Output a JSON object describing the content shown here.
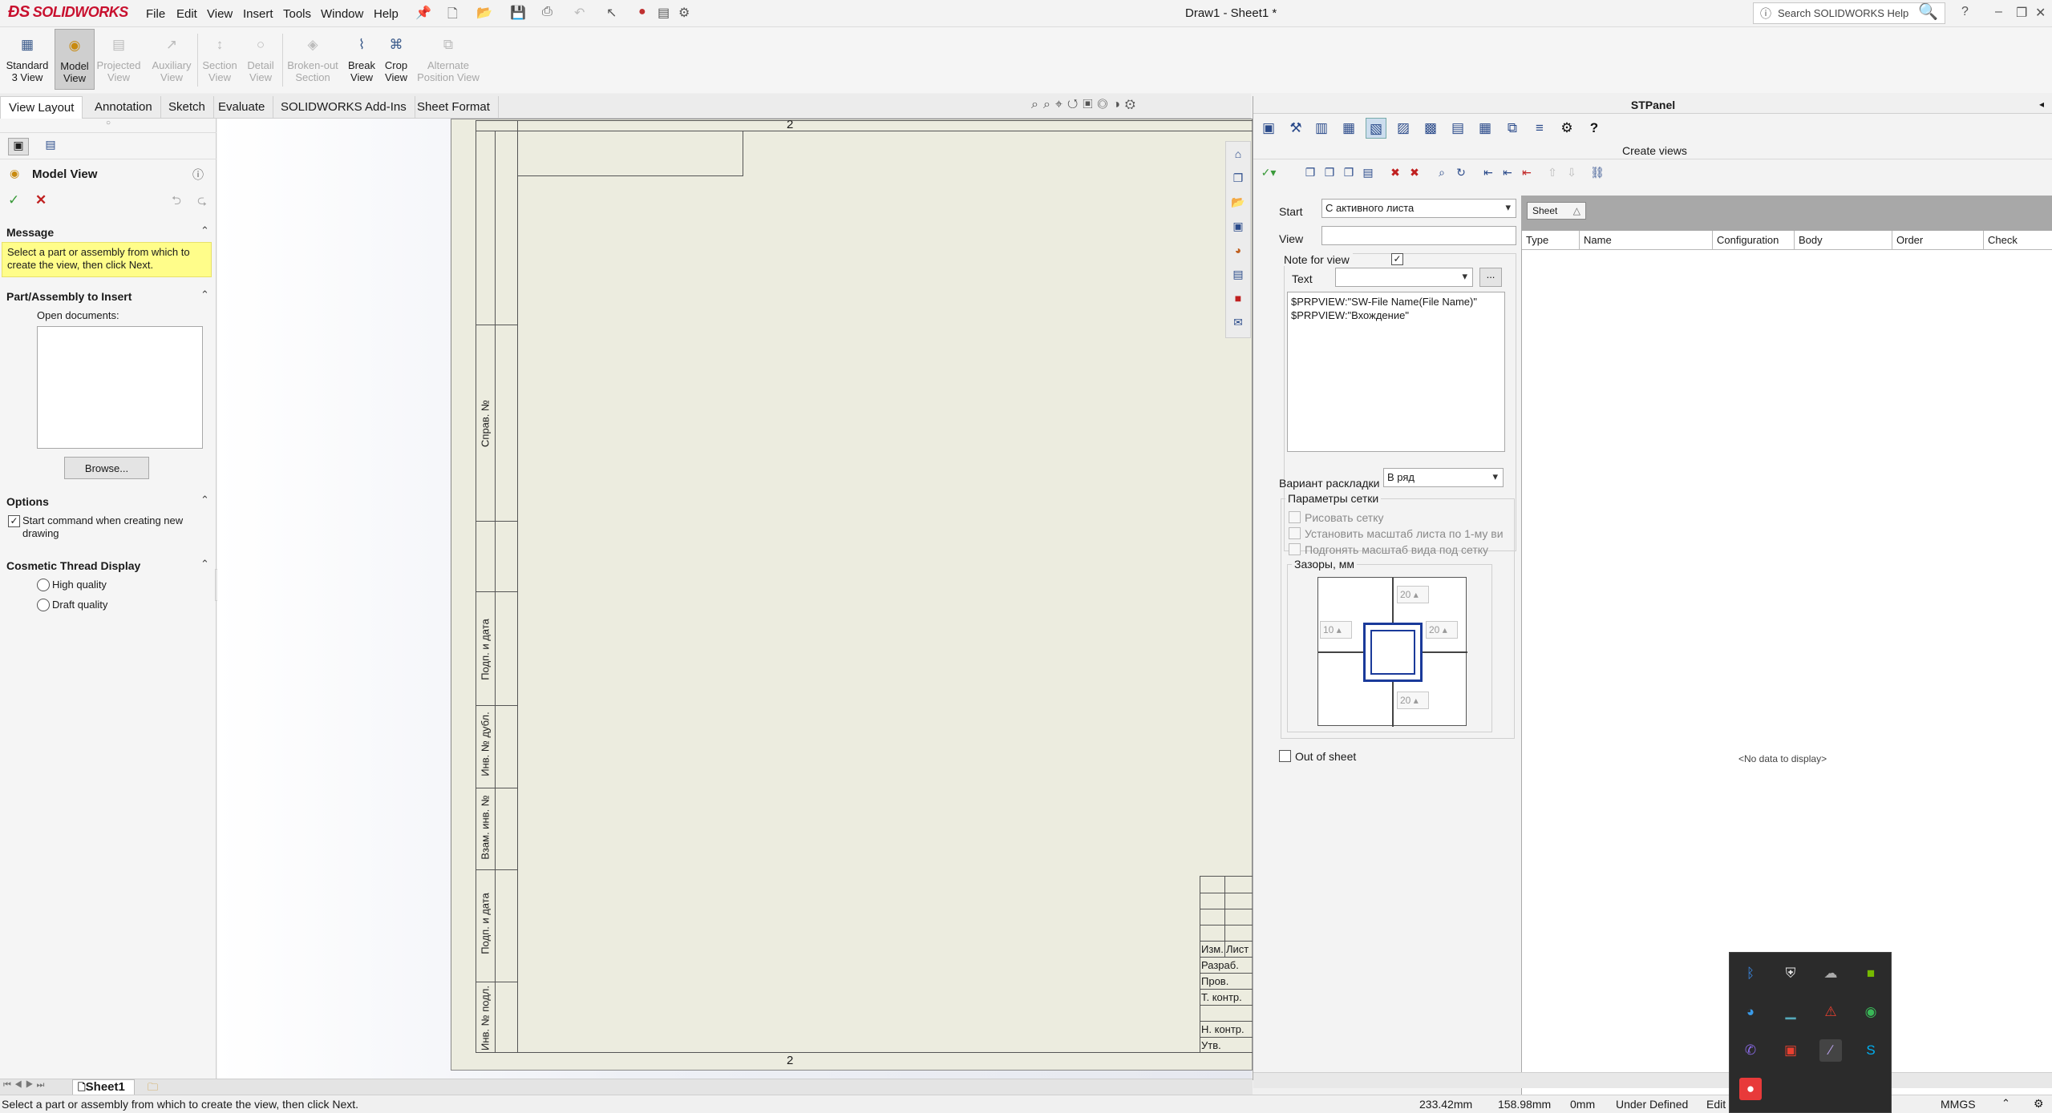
{
  "app": {
    "brand": "SOLIDWORKS",
    "window_title": "Draw1 - Sheet1 *",
    "help_search_placeholder": "Search SOLIDWORKS Help"
  },
  "menu": [
    "File",
    "Edit",
    "View",
    "Insert",
    "Tools",
    "Window",
    "Help"
  ],
  "commands": [
    {
      "label": "Standard 3 View",
      "icon": "standard-3-view-icon",
      "enabled": true,
      "active": false
    },
    {
      "label": "Model View",
      "icon": "model-view-icon",
      "enabled": true,
      "active": true
    },
    {
      "label": "Projected View",
      "icon": "projected-view-icon",
      "enabled": false
    },
    {
      "label": "Auxiliary View",
      "icon": "auxiliary-view-icon",
      "enabled": false
    },
    {
      "label": "Section View",
      "icon": "section-view-icon",
      "enabled": false
    },
    {
      "label": "Detail View",
      "icon": "detail-view-icon",
      "enabled": false
    },
    {
      "label": "Broken-out Section",
      "icon": "broken-out-section-icon",
      "enabled": false
    },
    {
      "label": "Break View",
      "icon": "break-view-icon",
      "enabled": true
    },
    {
      "label": "Crop View",
      "icon": "crop-view-icon",
      "enabled": true
    },
    {
      "label": "Alternate Position View",
      "icon": "alternate-position-view-icon",
      "enabled": false
    }
  ],
  "tabs": [
    "View Layout",
    "Annotation",
    "Sketch",
    "Evaluate",
    "SOLIDWORKS Add-Ins",
    "Sheet Format"
  ],
  "property_manager": {
    "title": "Model View",
    "message_header": "Message",
    "message_text": "Select a part or assembly from which to create the view, then click Next.",
    "part_header": "Part/Assembly to Insert",
    "open_docs_label": "Open documents:",
    "browse_label": "Browse...",
    "options_header": "Options",
    "start_command_label": "Start command when creating new drawing",
    "start_command_checked": true,
    "thread_header": "Cosmetic Thread Display",
    "high_quality_label": "High quality",
    "draft_quality_label": "Draft quality"
  },
  "drawing": {
    "zone_top": "2",
    "zone_bottom": "2",
    "side_labels": [
      "Справ. №",
      "Подп. и дата",
      "Инв. № дубл.",
      "Взам. инв. №",
      "Подп. и дата",
      "Инв. № подл."
    ],
    "title_rows": [
      "Изм.",
      "Лист",
      "Разраб.",
      "Пров.",
      "Т. контр.",
      "Н. контр.",
      "Утв."
    ]
  },
  "stpanel": {
    "title": "STPanel",
    "section_title": "Create views",
    "start_label": "Start",
    "start_value": "С активного листа",
    "view_label": "View",
    "view_value": "",
    "note_label": "Note for view",
    "note_checked": true,
    "text_label": "Text",
    "ellipsis": "...",
    "note_text_line1": "$PRPVIEW:\"SW-File Name(File Name)\"",
    "note_text_line2": "$PRPVIEW:\"Вхождение\"",
    "layout_label": "Вариант раскладки",
    "layout_value": "В ряд",
    "grid_params_label": "Параметры сетки",
    "draw_grid_label": "Рисовать сетку",
    "set_scale_label": "Установить масштаб листа по 1-му ви",
    "fit_scale_label": "Подгонять масштаб вида под сетку",
    "gaps_label": "Зазоры, мм",
    "gap_top": "20",
    "gap_left": "10",
    "gap_right": "20",
    "gap_bottom": "20",
    "out_of_sheet_label": "Out of sheet",
    "sheet_chip": "Sheet",
    "columns": [
      "Type",
      "Name",
      "Configuration",
      "Body",
      "Order",
      "Check"
    ],
    "no_data": "<No data to display>"
  },
  "sheet_tab": "Sheet1",
  "status": {
    "message": "Select a part or assembly from which to create the view, then click Next.",
    "x": "233.42mm",
    "y": "158.98mm",
    "z": "0mm",
    "state": "Under Defined",
    "edit": "Edit",
    "units": "MMGS"
  }
}
